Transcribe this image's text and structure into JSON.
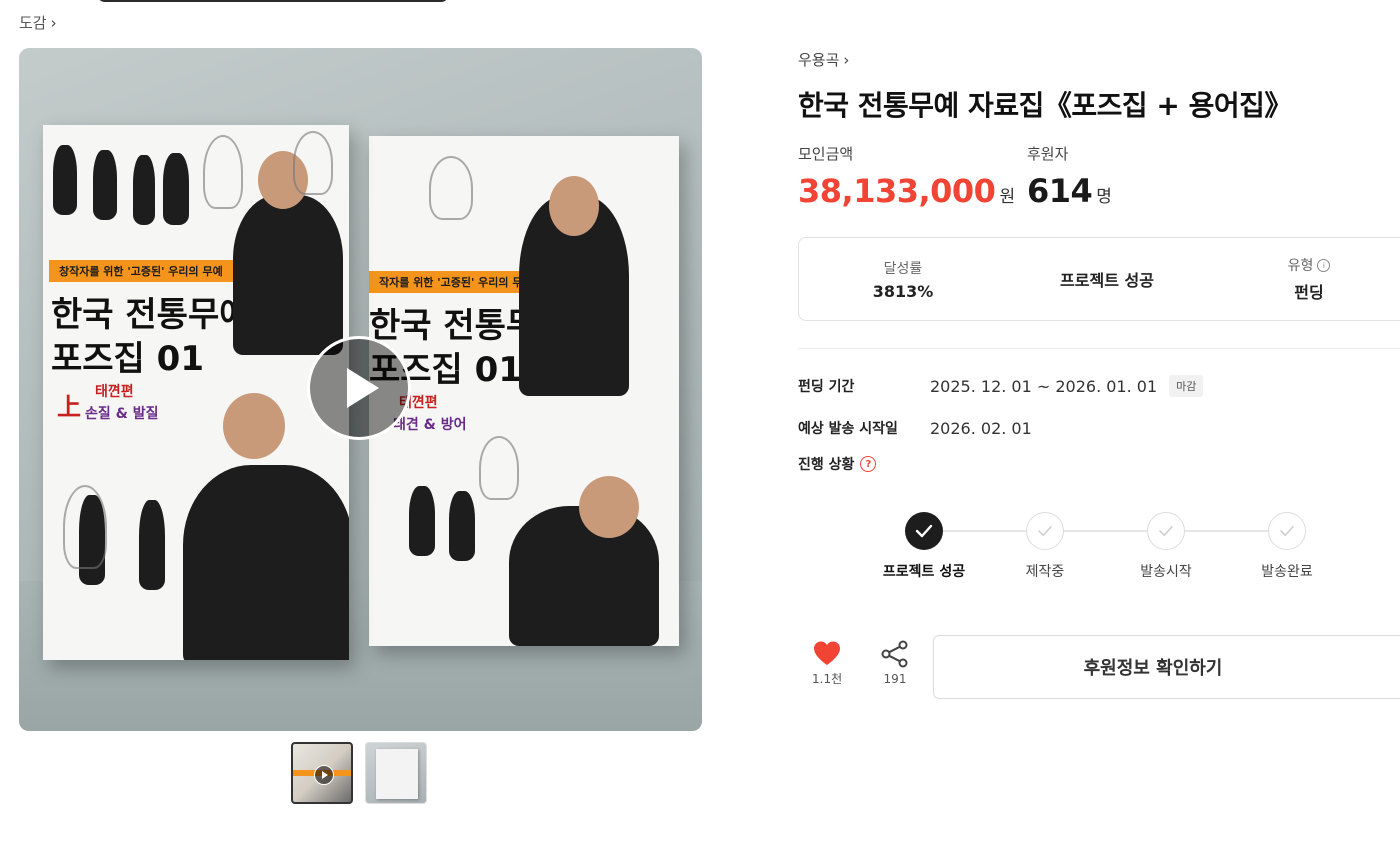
{
  "breadcrumb": {
    "label": "도감"
  },
  "media": {
    "cover_front": {
      "tagline": "창작자를 위한 '고증된' 우리의 무예",
      "title_line1": "한국 전통무예",
      "title_line2": "포즈집 01",
      "volume_mark": "上",
      "volume_sub1": "태껸편",
      "volume_sub2": "손질 & 발질"
    },
    "cover_back": {
      "tagline": "작자를 위한 '고증된' 우리의 무예",
      "title_line1": "한국 전통무예",
      "title_line2": "포즈집 01",
      "volume_sub1": "태껸편",
      "volume_sub2": "태견 & 방어"
    }
  },
  "project": {
    "creator": "우용곡",
    "title": "한국 전통무예 자료집《포즈집 + 용어집》",
    "amount_label": "모인금액",
    "amount_value": "38,133,000",
    "amount_unit": "원",
    "backers_label": "후원자",
    "backers_value": "614",
    "backers_unit": "명"
  },
  "summary": {
    "rate_label": "달성률",
    "rate_value": "3813%",
    "status_value": "프로젝트 성공",
    "type_label": "유형",
    "type_value": "펀딩"
  },
  "details": {
    "period_label": "펀딩 기간",
    "period_value": "2025. 12. 01 ~ 2026. 01. 01",
    "period_badge": "마감",
    "ship_label": "예상 발송 시작일",
    "ship_value": "2026. 02. 01",
    "progress_label": "진행 상황"
  },
  "steps": [
    {
      "label": "프로젝트 성공",
      "state": "done"
    },
    {
      "label": "제작중",
      "state": "todo"
    },
    {
      "label": "발송시작",
      "state": "todo"
    },
    {
      "label": "발송완료",
      "state": "todo"
    }
  ],
  "actions": {
    "like_count": "1.1천",
    "share_count": "191",
    "cta_label": "후원정보 확인하기"
  },
  "colors": {
    "accent": "#f24434",
    "step_done": "#1d1d1d",
    "cover_tag": "#f4941c"
  }
}
